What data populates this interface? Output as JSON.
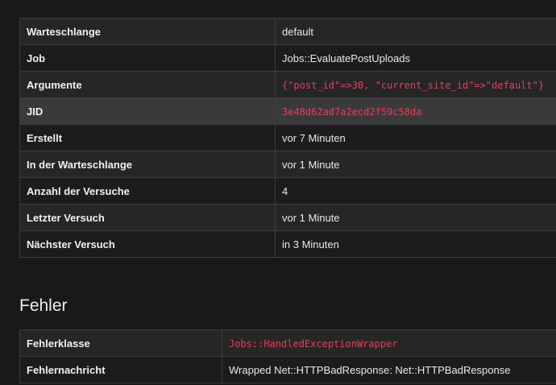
{
  "job_details": {
    "rows": [
      {
        "label": "Warteschlange",
        "value": "default"
      },
      {
        "label": "Job",
        "value": "Jobs::EvaluatePostUploads"
      },
      {
        "label": "Argumente",
        "value": "{\"post_id\"=>30, \"current_site_id\"=>\"default\"}"
      },
      {
        "label": "JID",
        "value": "3e48d62ad7a2ecd2f59c58da"
      },
      {
        "label": "Erstellt",
        "value": "vor 7 Minuten"
      },
      {
        "label": "In der Warteschlange",
        "value": "vor 1 Minute"
      },
      {
        "label": "Anzahl der Versuche",
        "value": "4"
      },
      {
        "label": "Letzter Versuch",
        "value": "vor 1 Minute"
      },
      {
        "label": "Nächster Versuch",
        "value": "in 3 Minuten"
      }
    ]
  },
  "error_section": {
    "title": "Fehler",
    "rows": [
      {
        "label": "Fehlerklasse",
        "value": "Jobs::HandledExceptionWrapper"
      },
      {
        "label": "Fehlernachricht",
        "value": "Wrapped Net::HTTPBadResponse: Net::HTTPBadResponse"
      }
    ]
  },
  "colors": {
    "background": "#191919",
    "code": "#e0415d",
    "highlight_row": "#3a3a3a"
  }
}
